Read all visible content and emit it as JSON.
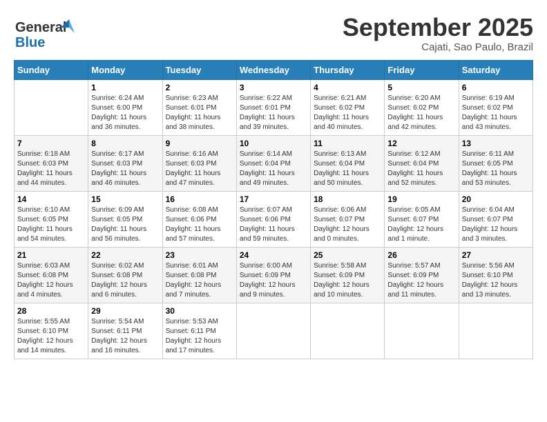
{
  "header": {
    "logo_line1": "General",
    "logo_line2": "Blue",
    "month": "September 2025",
    "location": "Cajati, Sao Paulo, Brazil"
  },
  "weekdays": [
    "Sunday",
    "Monday",
    "Tuesday",
    "Wednesday",
    "Thursday",
    "Friday",
    "Saturday"
  ],
  "weeks": [
    [
      {
        "day": "",
        "sunrise": "",
        "sunset": "",
        "daylight": ""
      },
      {
        "day": "1",
        "sunrise": "6:24 AM",
        "sunset": "6:00 PM",
        "daylight": "11 hours and 36 minutes."
      },
      {
        "day": "2",
        "sunrise": "6:23 AM",
        "sunset": "6:01 PM",
        "daylight": "11 hours and 38 minutes."
      },
      {
        "day": "3",
        "sunrise": "6:22 AM",
        "sunset": "6:01 PM",
        "daylight": "11 hours and 39 minutes."
      },
      {
        "day": "4",
        "sunrise": "6:21 AM",
        "sunset": "6:02 PM",
        "daylight": "11 hours and 40 minutes."
      },
      {
        "day": "5",
        "sunrise": "6:20 AM",
        "sunset": "6:02 PM",
        "daylight": "11 hours and 42 minutes."
      },
      {
        "day": "6",
        "sunrise": "6:19 AM",
        "sunset": "6:02 PM",
        "daylight": "11 hours and 43 minutes."
      }
    ],
    [
      {
        "day": "7",
        "sunrise": "6:18 AM",
        "sunset": "6:03 PM",
        "daylight": "11 hours and 44 minutes."
      },
      {
        "day": "8",
        "sunrise": "6:17 AM",
        "sunset": "6:03 PM",
        "daylight": "11 hours and 46 minutes."
      },
      {
        "day": "9",
        "sunrise": "6:16 AM",
        "sunset": "6:03 PM",
        "daylight": "11 hours and 47 minutes."
      },
      {
        "day": "10",
        "sunrise": "6:14 AM",
        "sunset": "6:04 PM",
        "daylight": "11 hours and 49 minutes."
      },
      {
        "day": "11",
        "sunrise": "6:13 AM",
        "sunset": "6:04 PM",
        "daylight": "11 hours and 50 minutes."
      },
      {
        "day": "12",
        "sunrise": "6:12 AM",
        "sunset": "6:04 PM",
        "daylight": "11 hours and 52 minutes."
      },
      {
        "day": "13",
        "sunrise": "6:11 AM",
        "sunset": "6:05 PM",
        "daylight": "11 hours and 53 minutes."
      }
    ],
    [
      {
        "day": "14",
        "sunrise": "6:10 AM",
        "sunset": "6:05 PM",
        "daylight": "11 hours and 54 minutes."
      },
      {
        "day": "15",
        "sunrise": "6:09 AM",
        "sunset": "6:05 PM",
        "daylight": "11 hours and 56 minutes."
      },
      {
        "day": "16",
        "sunrise": "6:08 AM",
        "sunset": "6:06 PM",
        "daylight": "11 hours and 57 minutes."
      },
      {
        "day": "17",
        "sunrise": "6:07 AM",
        "sunset": "6:06 PM",
        "daylight": "11 hours and 59 minutes."
      },
      {
        "day": "18",
        "sunrise": "6:06 AM",
        "sunset": "6:07 PM",
        "daylight": "12 hours and 0 minutes."
      },
      {
        "day": "19",
        "sunrise": "6:05 AM",
        "sunset": "6:07 PM",
        "daylight": "12 hours and 1 minute."
      },
      {
        "day": "20",
        "sunrise": "6:04 AM",
        "sunset": "6:07 PM",
        "daylight": "12 hours and 3 minutes."
      }
    ],
    [
      {
        "day": "21",
        "sunrise": "6:03 AM",
        "sunset": "6:08 PM",
        "daylight": "12 hours and 4 minutes."
      },
      {
        "day": "22",
        "sunrise": "6:02 AM",
        "sunset": "6:08 PM",
        "daylight": "12 hours and 6 minutes."
      },
      {
        "day": "23",
        "sunrise": "6:01 AM",
        "sunset": "6:08 PM",
        "daylight": "12 hours and 7 minutes."
      },
      {
        "day": "24",
        "sunrise": "6:00 AM",
        "sunset": "6:09 PM",
        "daylight": "12 hours and 9 minutes."
      },
      {
        "day": "25",
        "sunrise": "5:58 AM",
        "sunset": "6:09 PM",
        "daylight": "12 hours and 10 minutes."
      },
      {
        "day": "26",
        "sunrise": "5:57 AM",
        "sunset": "6:09 PM",
        "daylight": "12 hours and 11 minutes."
      },
      {
        "day": "27",
        "sunrise": "5:56 AM",
        "sunset": "6:10 PM",
        "daylight": "12 hours and 13 minutes."
      }
    ],
    [
      {
        "day": "28",
        "sunrise": "5:55 AM",
        "sunset": "6:10 PM",
        "daylight": "12 hours and 14 minutes."
      },
      {
        "day": "29",
        "sunrise": "5:54 AM",
        "sunset": "6:11 PM",
        "daylight": "12 hours and 16 minutes."
      },
      {
        "day": "30",
        "sunrise": "5:53 AM",
        "sunset": "6:11 PM",
        "daylight": "12 hours and 17 minutes."
      },
      {
        "day": "",
        "sunrise": "",
        "sunset": "",
        "daylight": ""
      },
      {
        "day": "",
        "sunrise": "",
        "sunset": "",
        "daylight": ""
      },
      {
        "day": "",
        "sunrise": "",
        "sunset": "",
        "daylight": ""
      },
      {
        "day": "",
        "sunrise": "",
        "sunset": "",
        "daylight": ""
      }
    ]
  ]
}
